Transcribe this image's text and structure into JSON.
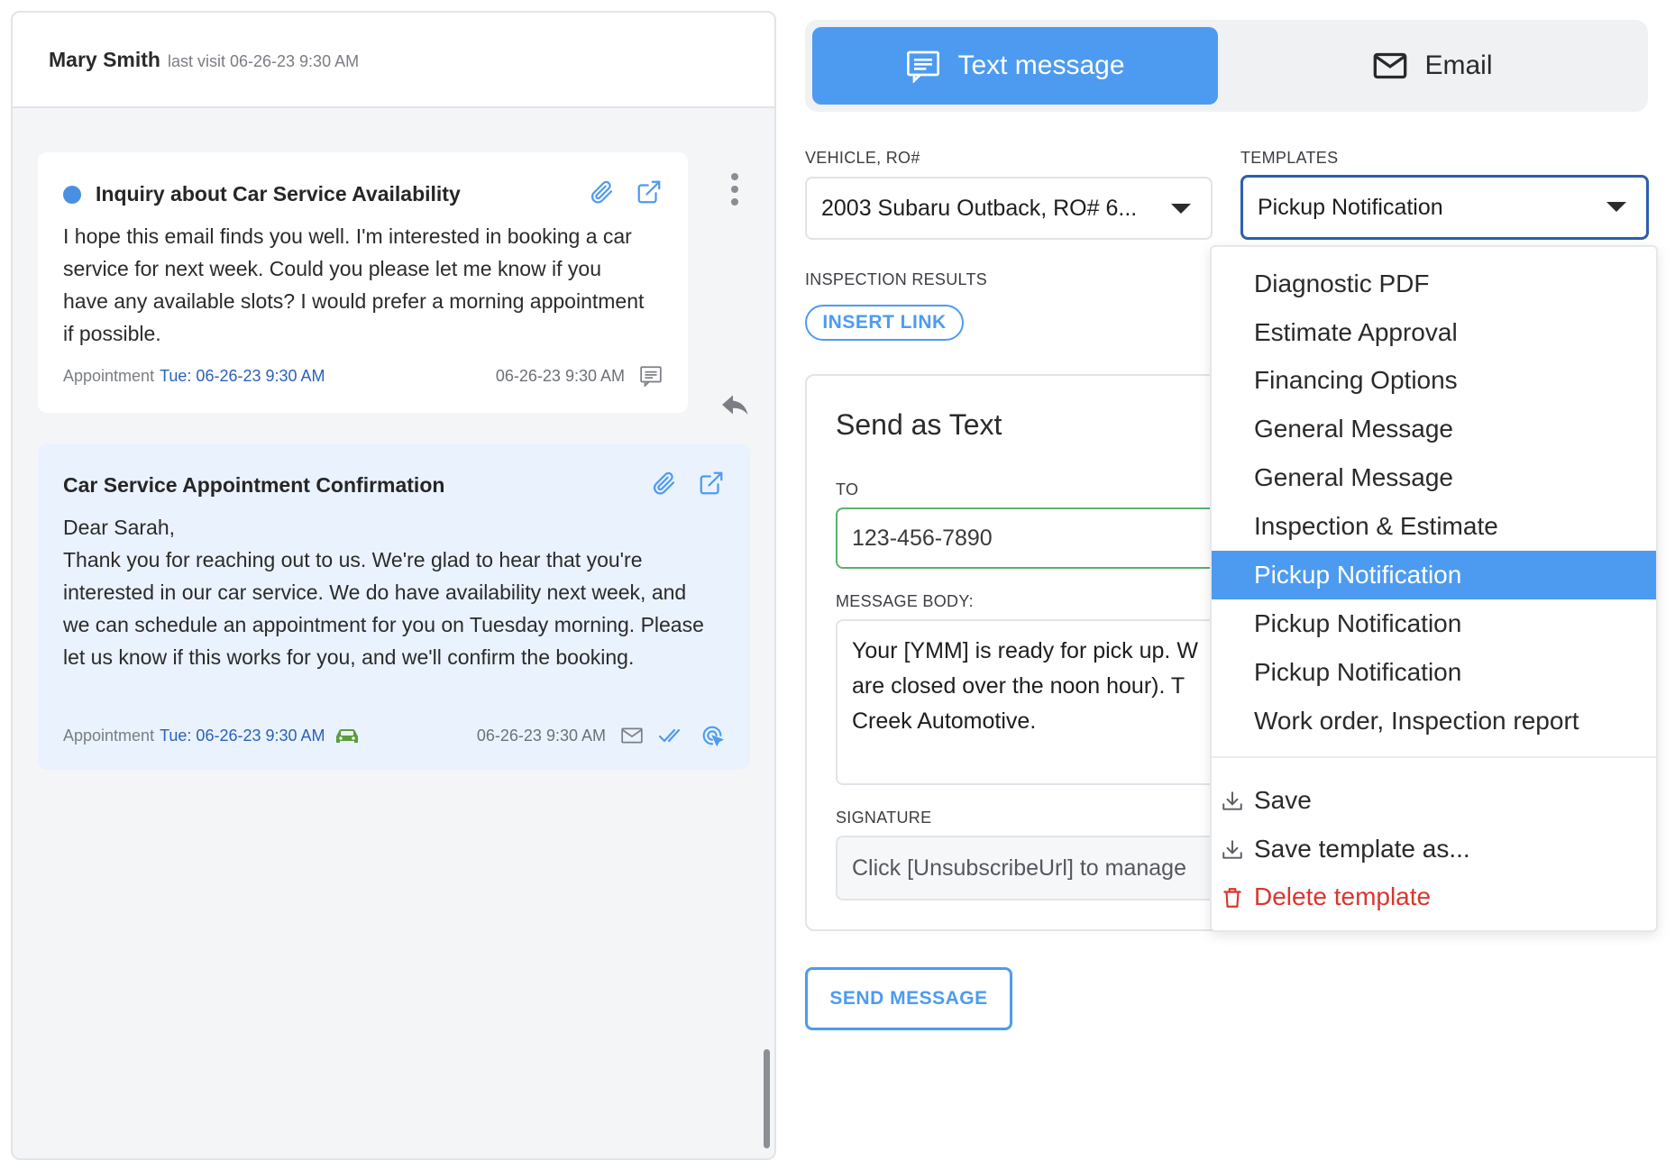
{
  "customer": {
    "name": "Mary Smith",
    "last_visit": "last visit 06-26-23 9:30 AM"
  },
  "messages": [
    {
      "title": "Inquiry about Car Service Availability",
      "body": "I hope this email finds you well. I'm interested in booking a car service for next week. Could you please let me know if you have any available slots? I would prefer a morning appointment if possible.",
      "appointment_label": "Appointment",
      "appointment_value": "Tue: 06-26-23 9:30 AM",
      "timestamp": "06-26-23 9:30 AM"
    },
    {
      "title": "Car Service Appointment Confirmation",
      "body": "Dear Sarah,\nThank you for reaching out to us. We're glad to hear that you're interested in our car service. We do have availability next week, and we can schedule an appointment for you on Tuesday morning. Please let us know if this works for you, and we'll confirm the booking.",
      "appointment_label": "Appointment",
      "appointment_value": "Tue: 06-26-23 9:30 AM",
      "timestamp": "06-26-23 9:30 AM"
    }
  ],
  "tabs": {
    "text_message": "Text message",
    "email": "Email"
  },
  "form": {
    "vehicle_label": "VEHICLE, RO#",
    "vehicle_value": "2003 Subaru Outback, RO# 6...",
    "templates_label": "TEMPLATES",
    "templates_value": "Pickup Notification",
    "inspection_label": "INSPECTION RESULTS",
    "insert_link": "INSERT LINK",
    "send_title": "Send as Text",
    "to_label": "TO",
    "to_value": "123-456-7890",
    "body_label": "MESSAGE BODY:",
    "body_value": "Your [YMM] is ready for pick up. We are closed over the noon hour). The Creek Automotive.",
    "body_line1": "Your [YMM] is ready for pick up. W",
    "body_line2": "are closed over the noon hour). T",
    "body_line3": "Creek Automotive.",
    "signature_label": "SIGNATURE",
    "signature_value": "Click [UnsubscribeUrl] to manage",
    "send_button": "SEND MESSAGE"
  },
  "template_dropdown": {
    "items": [
      "Diagnostic PDF",
      "Estimate Approval",
      "Financing Options",
      "General Message",
      "General Message",
      "Inspection & Estimate",
      "Pickup Notification",
      "Pickup Notification",
      "Pickup Notification",
      "Work order, Inspection report"
    ],
    "selected_index": 6,
    "actions": {
      "save": "Save",
      "save_as": "Save template as...",
      "delete": "Delete template"
    }
  },
  "colors": {
    "accent": "#4d9bf0",
    "link": "#2a62b9",
    "danger": "#d9362f",
    "car_icon": "#5a9e3a"
  }
}
